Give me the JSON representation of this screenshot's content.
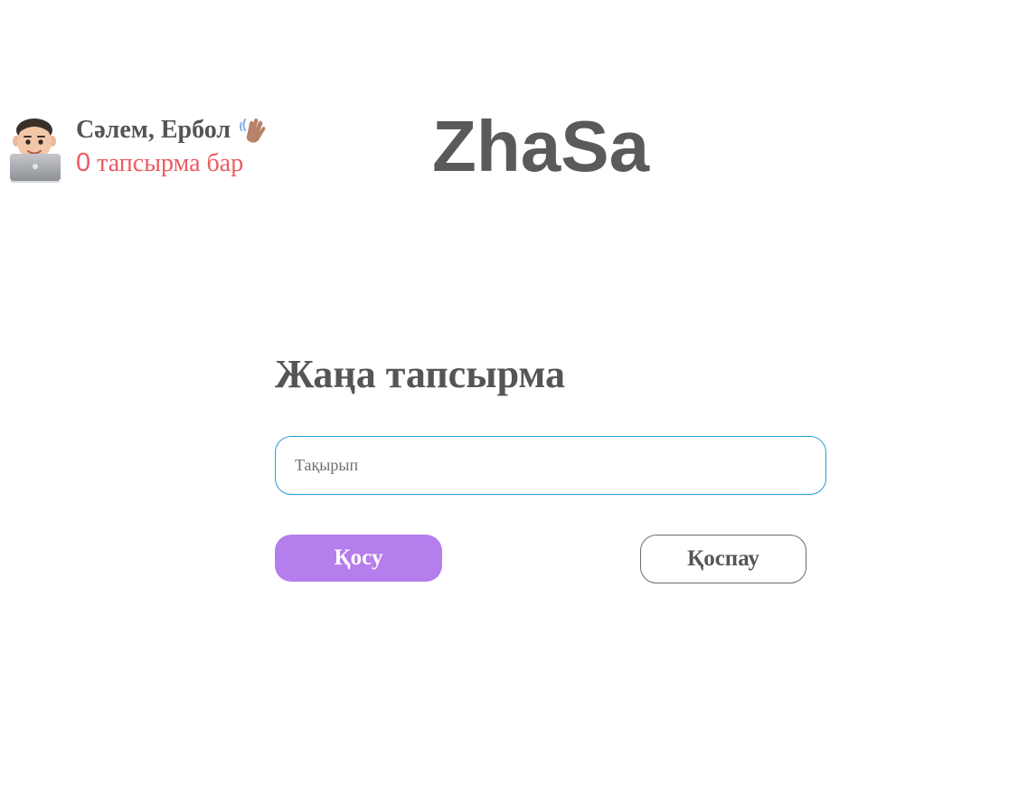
{
  "header": {
    "user_greeting": "Сәлем, Ербол",
    "task_count": "0",
    "task_count_suffix": "тапсырма бар",
    "app_title": "ZhaSa",
    "avatar_icon": "memoji-laptop-icon",
    "wave_icon": "waving-hand-icon"
  },
  "form": {
    "title": "Жаңа тапсырма",
    "input": {
      "placeholder": "Тақырып",
      "value": ""
    },
    "add_button_label": "Қосу",
    "cancel_button_label": "Қоспау"
  },
  "colors": {
    "accent_purple": "#b67ded",
    "count_red": "#ec5b62",
    "input_border": "#2c9bd6",
    "text_gray": "#555555"
  }
}
